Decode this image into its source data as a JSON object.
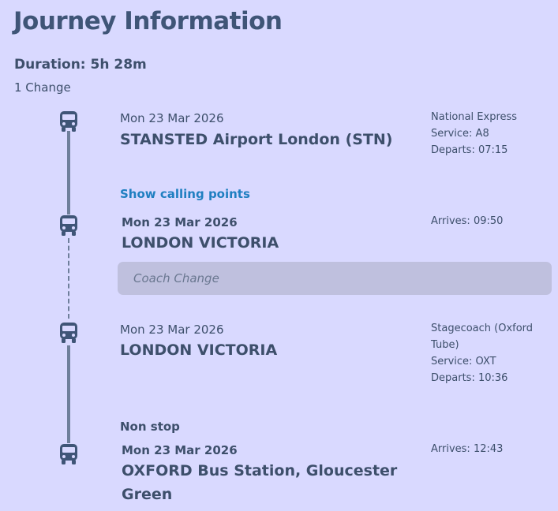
{
  "header": {
    "title": "Journey Information",
    "duration": "Duration: 5h 28m",
    "changes": "1 Change"
  },
  "legs": [
    {
      "date": "Mon 23 Mar 2026",
      "station": "STANSTED Airport London (STN)",
      "operator": "National Express",
      "service": "Service: A8",
      "time": "Departs: 07:15",
      "icon": "bus-icon"
    },
    {
      "date": "Mon 23 Mar 2026",
      "station": "LONDON VICTORIA",
      "time": "Arrives: 09:50",
      "icon": "bus-icon"
    },
    {
      "date": "Mon 23 Mar 2026",
      "station": "LONDON VICTORIA",
      "operator_line1": "Stagecoach (Oxford",
      "operator_line2": "Tube)",
      "service": "Service: OXT",
      "time": "Departs: 10:36",
      "icon": "bus-icon"
    },
    {
      "date": "Mon 23 Mar 2026",
      "station_line1": "OXFORD Bus Station, Gloucester",
      "station_line2": "Green",
      "time": "Arrives: 12:43",
      "icon": "bus-icon"
    }
  ],
  "calling_points_link": "Show calling points",
  "change_label": "Coach Change",
  "non_stop": "Non stop",
  "colors": {
    "background": "#d9d9ff",
    "text": "#3d4f6b",
    "title": "#3f5577",
    "link": "#1f7fc1",
    "change_bar": "#bfc0de",
    "timeline": "#6f7f9b"
  }
}
